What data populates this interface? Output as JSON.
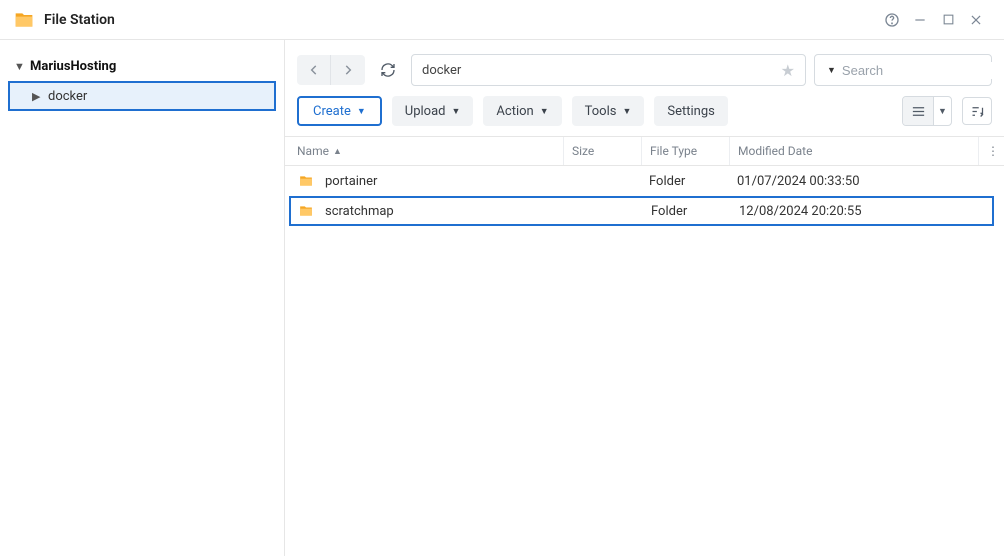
{
  "window": {
    "title": "File Station"
  },
  "sidebar": {
    "root": "MariusHosting",
    "child": "docker"
  },
  "path": "docker",
  "search": {
    "placeholder": "Search"
  },
  "toolbar": {
    "create": "Create",
    "upload": "Upload",
    "action": "Action",
    "tools": "Tools",
    "settings": "Settings"
  },
  "columns": {
    "name": "Name",
    "size": "Size",
    "type": "File Type",
    "date": "Modified Date"
  },
  "rows": [
    {
      "name": "portainer",
      "size": "",
      "type": "Folder",
      "date": "01/07/2024 00:33:50",
      "selected": false
    },
    {
      "name": "scratchmap",
      "size": "",
      "type": "Folder",
      "date": "12/08/2024 20:20:55",
      "selected": true
    }
  ]
}
